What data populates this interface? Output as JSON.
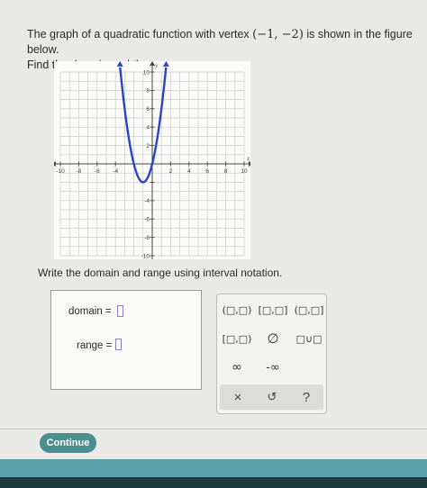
{
  "problem": {
    "text_before": "The graph of a quadratic function with vertex",
    "vertex": "(−1, −2)",
    "text_after": "is shown in the figure below.",
    "line2": "Find the domain and the range."
  },
  "graph": {
    "x_ticks": [
      "-10",
      "-8",
      "-6",
      "-4",
      "2",
      "4",
      "6",
      "8",
      "10"
    ],
    "y_ticks": [
      "10",
      "8",
      "6",
      "4",
      "2",
      "-4",
      "-6",
      "-8",
      "-10"
    ],
    "x_axis_label": "x",
    "y_axis_label": "y",
    "function": "y = 2(x+1)^2 - 2",
    "vertex": [
      -1,
      -2
    ],
    "xlim": [
      -10,
      10
    ],
    "ylim": [
      -10,
      10
    ]
  },
  "instruction": "Write the domain and range using interval notation.",
  "answer": {
    "domain_label": "domain =",
    "range_label": "range =",
    "domain_value": "",
    "range_value": ""
  },
  "keypad": {
    "open_open": "(□,□)",
    "closed_closed": "[□,□]",
    "open_closed": "(□,□]",
    "closed_open": "[□,□)",
    "empty_set": "∅",
    "union": "□∪□",
    "infinity": "∞",
    "neg_infinity": "-∞",
    "clear": "×",
    "undo": "↺",
    "help": "?"
  },
  "continue_label": "Continue",
  "colors": {
    "curve": "#2c43c4",
    "keypad_bg": "#f2f2f0",
    "continue_bg": "#4a8f8e",
    "answer_slot_border": "#8e7bd0"
  }
}
